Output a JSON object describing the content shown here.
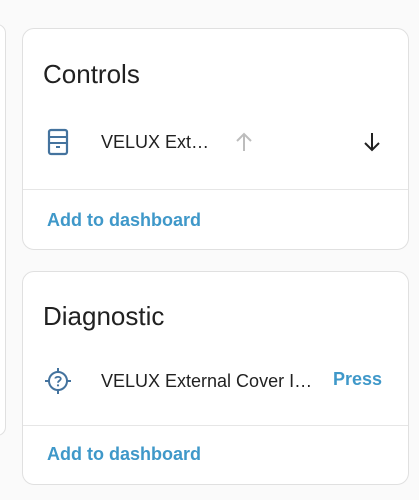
{
  "colors": {
    "accent": "#3f98c9",
    "icon": "#44739e",
    "disabled": "#bdbdbd",
    "text": "#212121"
  },
  "controls": {
    "title": "Controls",
    "entity": {
      "icon": "window-shutter-icon",
      "label": "VELUX External Cover"
    },
    "up_icon": "arrow-up-icon",
    "down_icon": "arrow-down-icon",
    "action_label": "Add to dashboard"
  },
  "diagnostic": {
    "title": "Diagnostic",
    "entity": {
      "icon": "crosshairs-question-icon",
      "label": "VELUX External Cover Identify"
    },
    "press_label": "Press",
    "action_label": "Add to dashboard"
  }
}
